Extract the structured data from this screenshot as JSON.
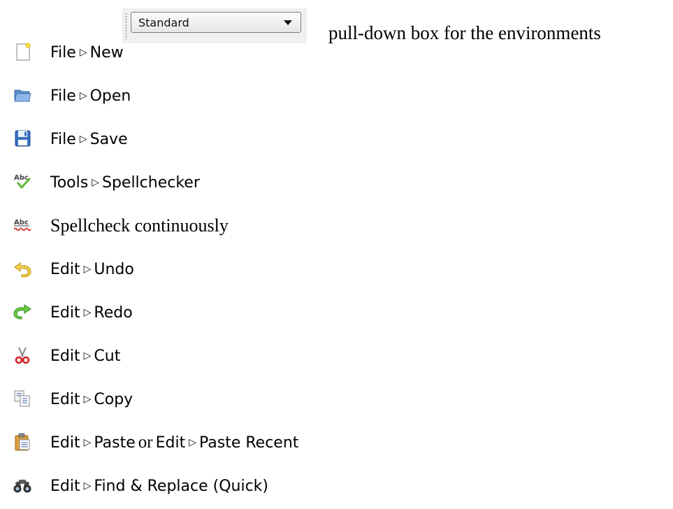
{
  "combo": {
    "value": "Standard",
    "caption": "pull-down box for the environments"
  },
  "rows": [
    {
      "icon": "new-document-icon",
      "menu": "File",
      "item": "New"
    },
    {
      "icon": "open-folder-icon",
      "menu": "File",
      "item": "Open"
    },
    {
      "icon": "save-floppy-icon",
      "menu": "File",
      "item": "Save"
    },
    {
      "icon": "spellcheck-icon",
      "menu": "Tools",
      "item": "Spellchecker"
    },
    {
      "icon": "spellcheck-continuous-icon",
      "text": "Spellcheck continuously"
    },
    {
      "icon": "undo-icon",
      "menu": "Edit",
      "item": "Undo"
    },
    {
      "icon": "redo-icon",
      "menu": "Edit",
      "item": "Redo"
    },
    {
      "icon": "scissors-icon",
      "menu": "Edit",
      "item": "Cut"
    },
    {
      "icon": "copy-icon",
      "menu": "Edit",
      "item": "Copy"
    },
    {
      "icon": "paste-icon",
      "menu": "Edit",
      "item": "Paste",
      "connector": "or",
      "menu2": "Edit",
      "item2": "Paste Recent"
    },
    {
      "icon": "binoculars-icon",
      "menu": "Edit",
      "item": "Find & Replace (Quick)"
    }
  ],
  "colors": {
    "undo": "#e8b830",
    "redo": "#4caf30",
    "scissors": "#d42020",
    "spell_check": "#5cb830",
    "spell_wave": "#d42020"
  }
}
